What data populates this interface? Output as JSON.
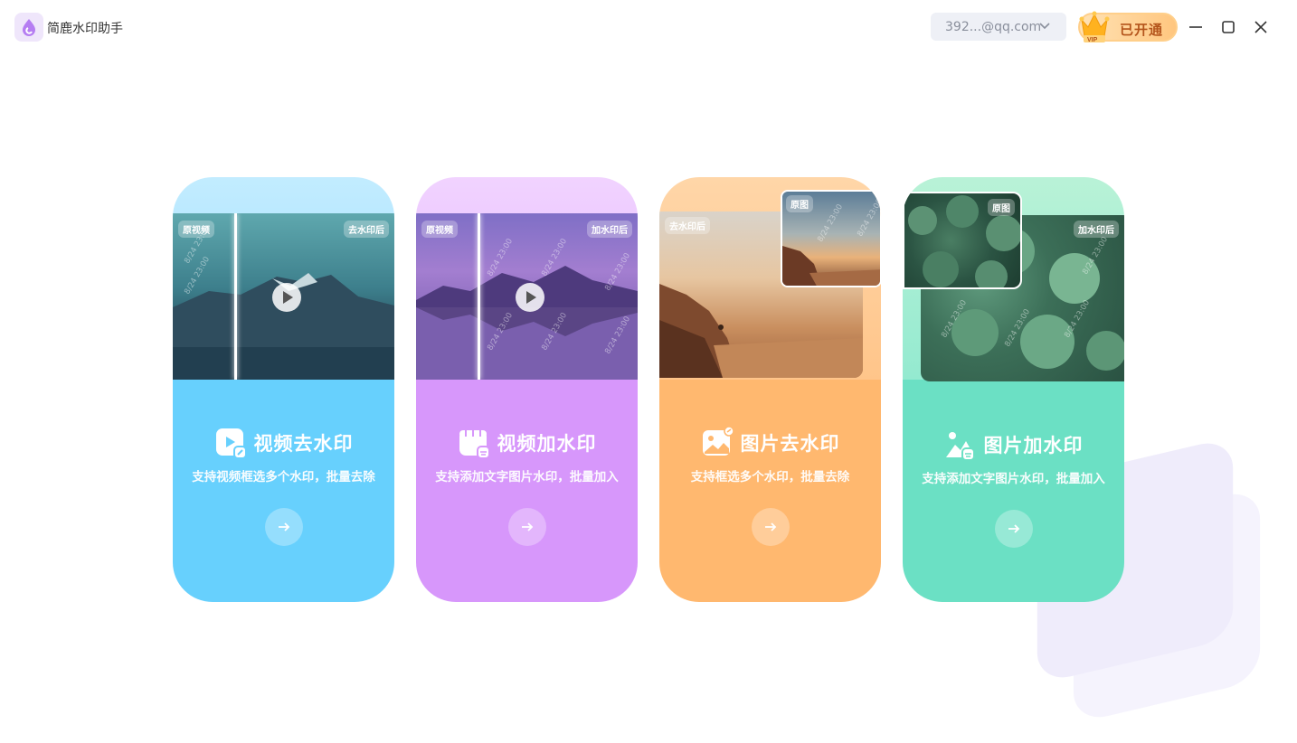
{
  "app": {
    "title": "简鹿水印助手"
  },
  "header": {
    "account": "392...@qq.com",
    "vip_label": "已开通",
    "vip_badge": "VIP"
  },
  "colors": {
    "card1": "#67d0fd",
    "card2": "#d797fb",
    "card3": "#ffb86f",
    "card4": "#6be0c4"
  },
  "cards": [
    {
      "title": "视频去水印",
      "desc": "支持视频框选多个水印，批量去除",
      "tag_left": "原视频",
      "tag_right": "去水印后",
      "icon": "video-icon"
    },
    {
      "title": "视频加水印",
      "desc": "支持添加文字图片水印，批量加入",
      "tag_left": "原视频",
      "tag_right": "加水印后",
      "icon": "calendar-video-icon"
    },
    {
      "title": "图片去水印",
      "desc": "支持框选多个水印，批量去除",
      "tag_left": "去水印后",
      "tag_right": "原图",
      "icon": "image-icon"
    },
    {
      "title": "图片加水印",
      "desc": "支持添加文字图片水印，批量加入",
      "tag_left": "原图",
      "tag_right": "加水印后",
      "icon": "landscape-icon"
    }
  ],
  "watermark_text": "8/24 23:00"
}
